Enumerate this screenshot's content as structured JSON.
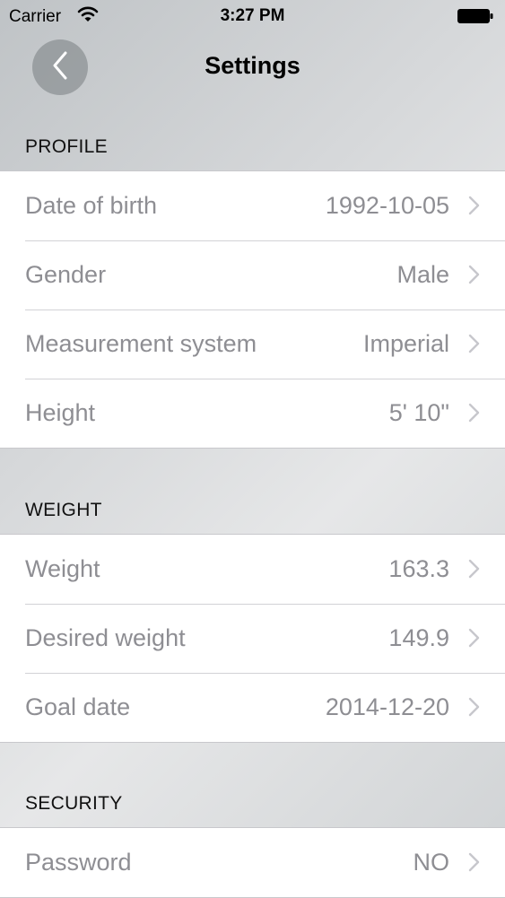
{
  "status_bar": {
    "carrier": "Carrier",
    "time": "3:27 PM",
    "wifi_icon": "wifi-icon",
    "battery_icon": "battery-icon"
  },
  "nav": {
    "title": "Settings",
    "back_icon": "chevron-left-icon"
  },
  "sections": {
    "profile": {
      "header": "PROFILE",
      "rows": [
        {
          "label": "Date of birth",
          "value": "1992-10-05"
        },
        {
          "label": "Gender",
          "value": "Male"
        },
        {
          "label": "Measurement system",
          "value": "Imperial"
        },
        {
          "label": "Height",
          "value": "5' 10\""
        }
      ]
    },
    "weight": {
      "header": "WEIGHT",
      "rows": [
        {
          "label": "Weight",
          "value": "163.3"
        },
        {
          "label": "Desired weight",
          "value": "149.9"
        },
        {
          "label": "Goal date",
          "value": "2014-12-20"
        }
      ]
    },
    "security": {
      "header": "SECURITY",
      "rows": [
        {
          "label": "Password",
          "value": "NO"
        }
      ]
    }
  },
  "colors": {
    "row_text": "#8e8e93",
    "row_background": "#ffffff",
    "separator": "#d2d2d6"
  }
}
